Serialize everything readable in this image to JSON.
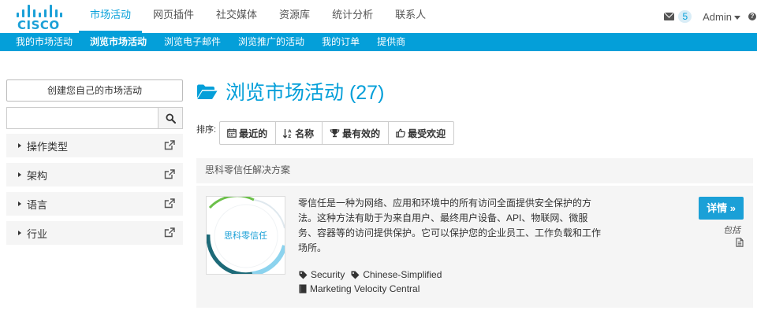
{
  "brand": {
    "logo_text": "CISCO",
    "accent": "#049fd9"
  },
  "nav": {
    "main": [
      "市场活动",
      "网页插件",
      "社交媒体",
      "资源库",
      "统计分析",
      "联系人"
    ],
    "active_index": 0,
    "mail_count": "5",
    "user": "Admin",
    "help_icon": "help-icon"
  },
  "subnav": {
    "items": [
      "我的市场活动",
      "浏览市场活动",
      "浏览电子邮件",
      "浏览推广的活动",
      "我的订单",
      "提供商"
    ],
    "active_index": 1
  },
  "sidebar": {
    "create_button": "创建您自己的市场活动",
    "search_placeholder": "",
    "filters": [
      "操作类型",
      "架构",
      "语言",
      "行业"
    ]
  },
  "main": {
    "title": "浏览市场活动 (27)",
    "sort_label": "排序:",
    "sort_options": [
      {
        "icon": "calendar-icon",
        "label": "最近的"
      },
      {
        "icon": "sort-alpha-icon",
        "label": "名称"
      },
      {
        "icon": "trophy-icon",
        "label": "最有效的"
      },
      {
        "icon": "thumbs-up-icon",
        "label": "最受欢迎"
      }
    ],
    "section_header": "思科零信任解决方案",
    "card": {
      "thumb_label": "思科零信任",
      "description": "零信任是一种为网络、应用和环境中的所有访问全面提供安全保护的方法。这种方法有助于为来自用户、最终用户设备、API、物联网、微服务、容器等的访问提供保护。它可以保护您的企业员工、工作负载和工作场所。",
      "details_button": "详情 »",
      "includes_label": "包括",
      "tags": [
        "Security",
        "Chinese-Simplified"
      ],
      "source": "Marketing Velocity Central"
    }
  }
}
